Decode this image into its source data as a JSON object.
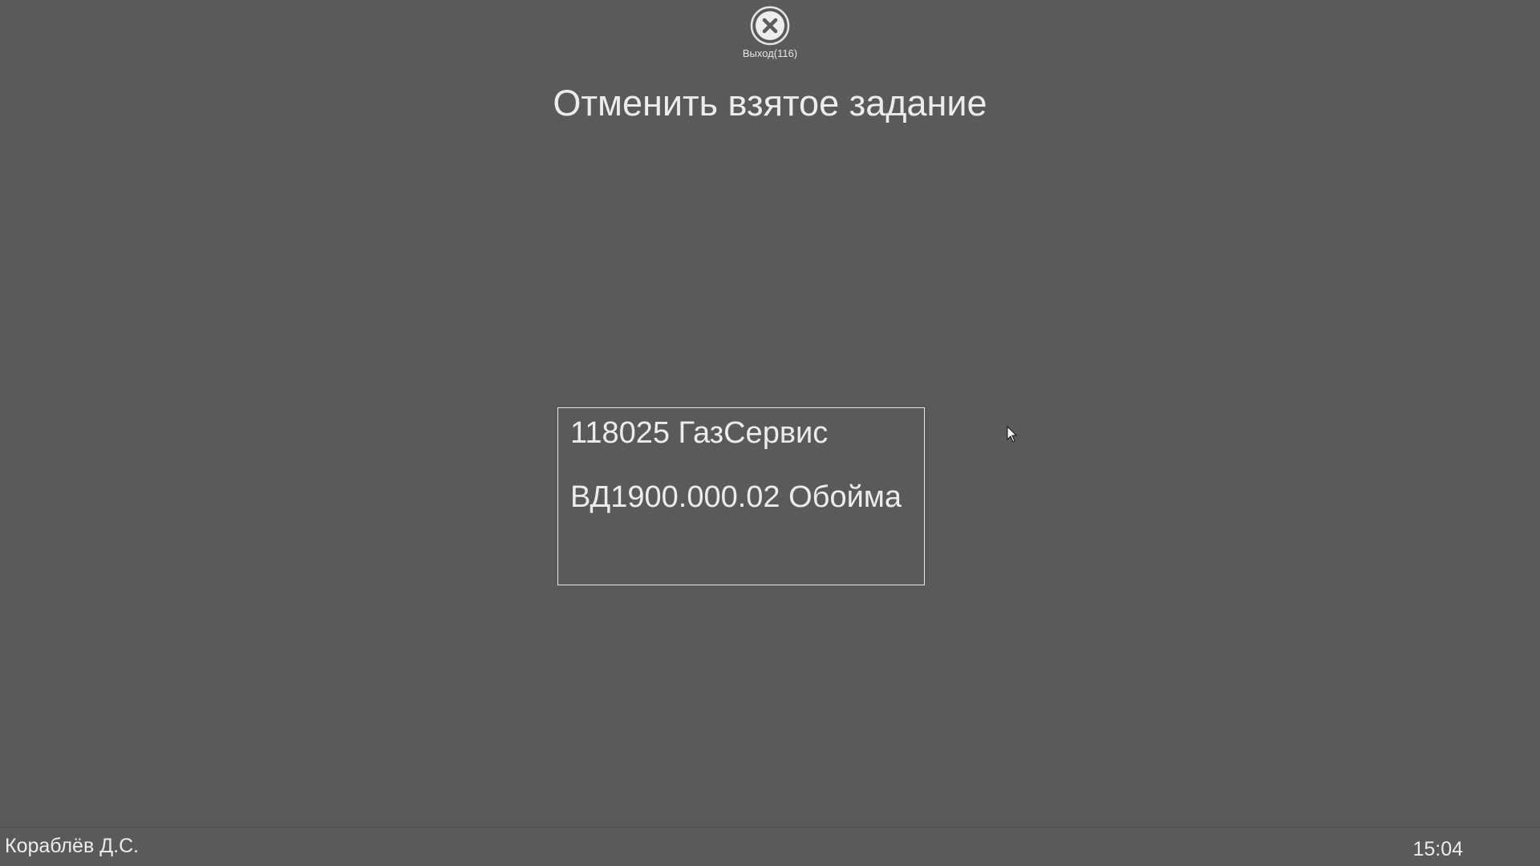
{
  "header": {
    "exit_label": "Выход(116)",
    "exit_icon": "close-circle-icon"
  },
  "page": {
    "title": "Отменить взятое задание"
  },
  "task": {
    "line1": "118025 ГазСервис",
    "line2": "ВД1900.000.02 Обойма"
  },
  "status_bar": {
    "user": "Кораблёв Д.С.",
    "time": "15:04"
  },
  "colors": {
    "background": "#5a5a5a",
    "text": "#ececec",
    "border": "#e8e8e8"
  }
}
